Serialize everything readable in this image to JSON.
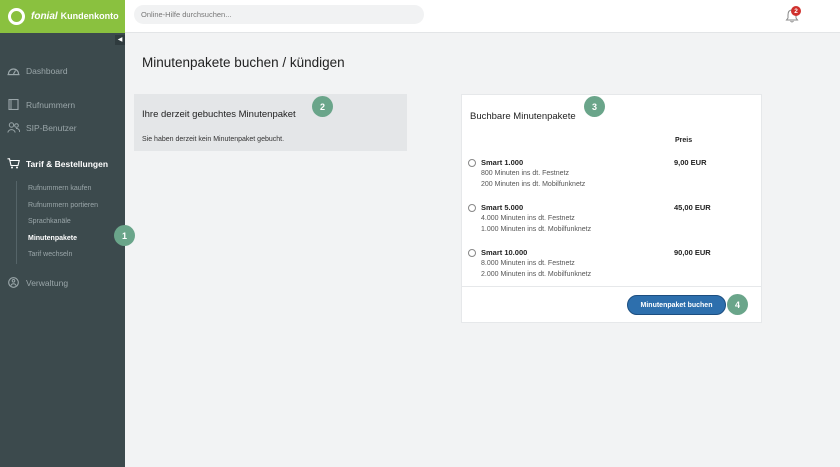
{
  "header": {
    "brand_bold": "fonial",
    "brand_name": "Kundenkonto",
    "search_placeholder": "Online-Hilfe durchsuchen...",
    "notification_count": "2"
  },
  "sidebar": {
    "collapse_glyph": "◀",
    "items": [
      {
        "label": "Dashboard",
        "icon": "dashboard-icon"
      },
      {
        "label": "Rufnummern",
        "icon": "phone-book-icon"
      },
      {
        "label": "SIP-Benutzer",
        "icon": "users-icon"
      },
      {
        "label": "Tarif & Bestellungen",
        "icon": "cart-icon"
      },
      {
        "label": "Verwaltung",
        "icon": "settings-icon"
      }
    ],
    "subitems": [
      "Rufnummern kaufen",
      "Rufnummern portieren",
      "Sprachkanäle",
      "Minutenpakete",
      "Tarif wechseln"
    ]
  },
  "main": {
    "title": "Minutenpakete buchen / kündigen",
    "current": {
      "heading": "Ihre derzeit gebuchtes Minutenpaket",
      "text": "Sie haben derzeit kein Minutenpaket gebucht."
    },
    "bookable": {
      "heading": "Buchbare Minutenpakete",
      "price_header": "Preis",
      "packages": [
        {
          "name": "Smart 1.000",
          "line1": "800 Minuten ins dt. Festnetz",
          "line2": "200 Minuten ins dt. Mobilfunknetz",
          "price": "9,00 EUR"
        },
        {
          "name": "Smart 5.000",
          "line1": "4.000 Minuten ins dt. Festnetz",
          "line2": "1.000 Minuten ins dt. Mobilfunknetz",
          "price": "45,00 EUR"
        },
        {
          "name": "Smart 10.000",
          "line1": "8.000 Minuten ins dt. Festnetz",
          "line2": "2.000 Minuten ins dt. Mobilfunknetz",
          "price": "90,00 EUR"
        }
      ],
      "button": "Minutenpaket buchen"
    }
  },
  "steps": [
    "1",
    "2",
    "3",
    "4"
  ],
  "colors": {
    "brand_green": "#8ac13f",
    "sidebar_bg": "#3c4a4d",
    "primary_button": "#2d6fad",
    "step_badge": "#6aa58a",
    "notification_badge": "#d0312d"
  }
}
